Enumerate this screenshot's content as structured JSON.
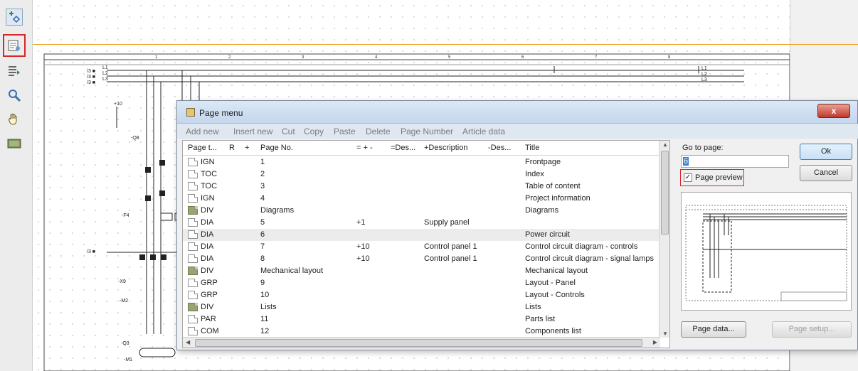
{
  "dialog": {
    "title": "Page menu",
    "close_label": "x",
    "menu": [
      "Add new",
      "Insert new",
      "Cut",
      "Copy",
      "Paste",
      "Delete",
      "Page Number",
      "Article data"
    ],
    "columns": [
      "Page t...",
      "R",
      "+",
      "Page No.",
      "= + -",
      "=Des...",
      "+Description",
      "-Des...",
      "Title"
    ],
    "rows": [
      {
        "type": "IGN",
        "page_no": "1",
        "plus": "",
        "plus_desc": "",
        "title": "Frontpage",
        "folder": false
      },
      {
        "type": "TOC",
        "page_no": "2",
        "plus": "",
        "plus_desc": "",
        "title": "Index",
        "folder": false
      },
      {
        "type": "TOC",
        "page_no": "3",
        "plus": "",
        "plus_desc": "",
        "title": "Table of content",
        "folder": false
      },
      {
        "type": "IGN",
        "page_no": "4",
        "plus": "",
        "plus_desc": "",
        "title": "Project information",
        "folder": false
      },
      {
        "type": "DIV",
        "page_no": "Diagrams",
        "plus": "",
        "plus_desc": "",
        "title": "Diagrams",
        "folder": true
      },
      {
        "type": "DIA",
        "page_no": "5",
        "plus": "+1",
        "plus_desc": "Supply panel",
        "title": "",
        "folder": false
      },
      {
        "type": "DIA",
        "page_no": "6",
        "plus": "",
        "plus_desc": "",
        "title": "Power circuit",
        "folder": false
      },
      {
        "type": "DIA",
        "page_no": "7",
        "plus": "+10",
        "plus_desc": "Control panel 1",
        "title": "Control circuit diagram - controls",
        "folder": false
      },
      {
        "type": "DIA",
        "page_no": "8",
        "plus": "+10",
        "plus_desc": "Control panel 1",
        "title": "Control circuit diagram - signal lamps",
        "folder": false
      },
      {
        "type": "DIV",
        "page_no": "Mechanical layout",
        "plus": "",
        "plus_desc": "",
        "title": "Mechanical layout",
        "folder": true
      },
      {
        "type": "GRP",
        "page_no": "9",
        "plus": "",
        "plus_desc": "",
        "title": "Layout - Panel",
        "folder": false
      },
      {
        "type": "GRP",
        "page_no": "10",
        "plus": "",
        "plus_desc": "",
        "title": "Layout - Controls",
        "folder": false
      },
      {
        "type": "DIV",
        "page_no": "Lists",
        "plus": "",
        "plus_desc": "",
        "title": "Lists",
        "folder": true
      },
      {
        "type": "PAR",
        "page_no": "11",
        "plus": "",
        "plus_desc": "",
        "title": "Parts list",
        "folder": false
      },
      {
        "type": "COM",
        "page_no": "12",
        "plus": "",
        "plus_desc": "",
        "title": "Components list",
        "folder": false
      }
    ],
    "selected_row": 6,
    "go_to_label": "Go to page:",
    "go_to_value": "6",
    "preview_label": "Page preview",
    "preview_checked": true,
    "ok_label": "Ok",
    "cancel_label": "Cancel",
    "page_data_label": "Page data...",
    "page_setup_label": "Page setup..."
  },
  "schematic": {
    "columns": [
      "1",
      "2",
      "3",
      "4",
      "5",
      "6",
      "7",
      "8"
    ],
    "lines": [
      "L1",
      "L2",
      "L3"
    ]
  },
  "toolbar": {
    "icons": [
      "symbol-insert-icon",
      "page-menu-icon",
      "list-icon",
      "zoom-icon",
      "pan-hand-icon",
      "screen-icon"
    ]
  }
}
